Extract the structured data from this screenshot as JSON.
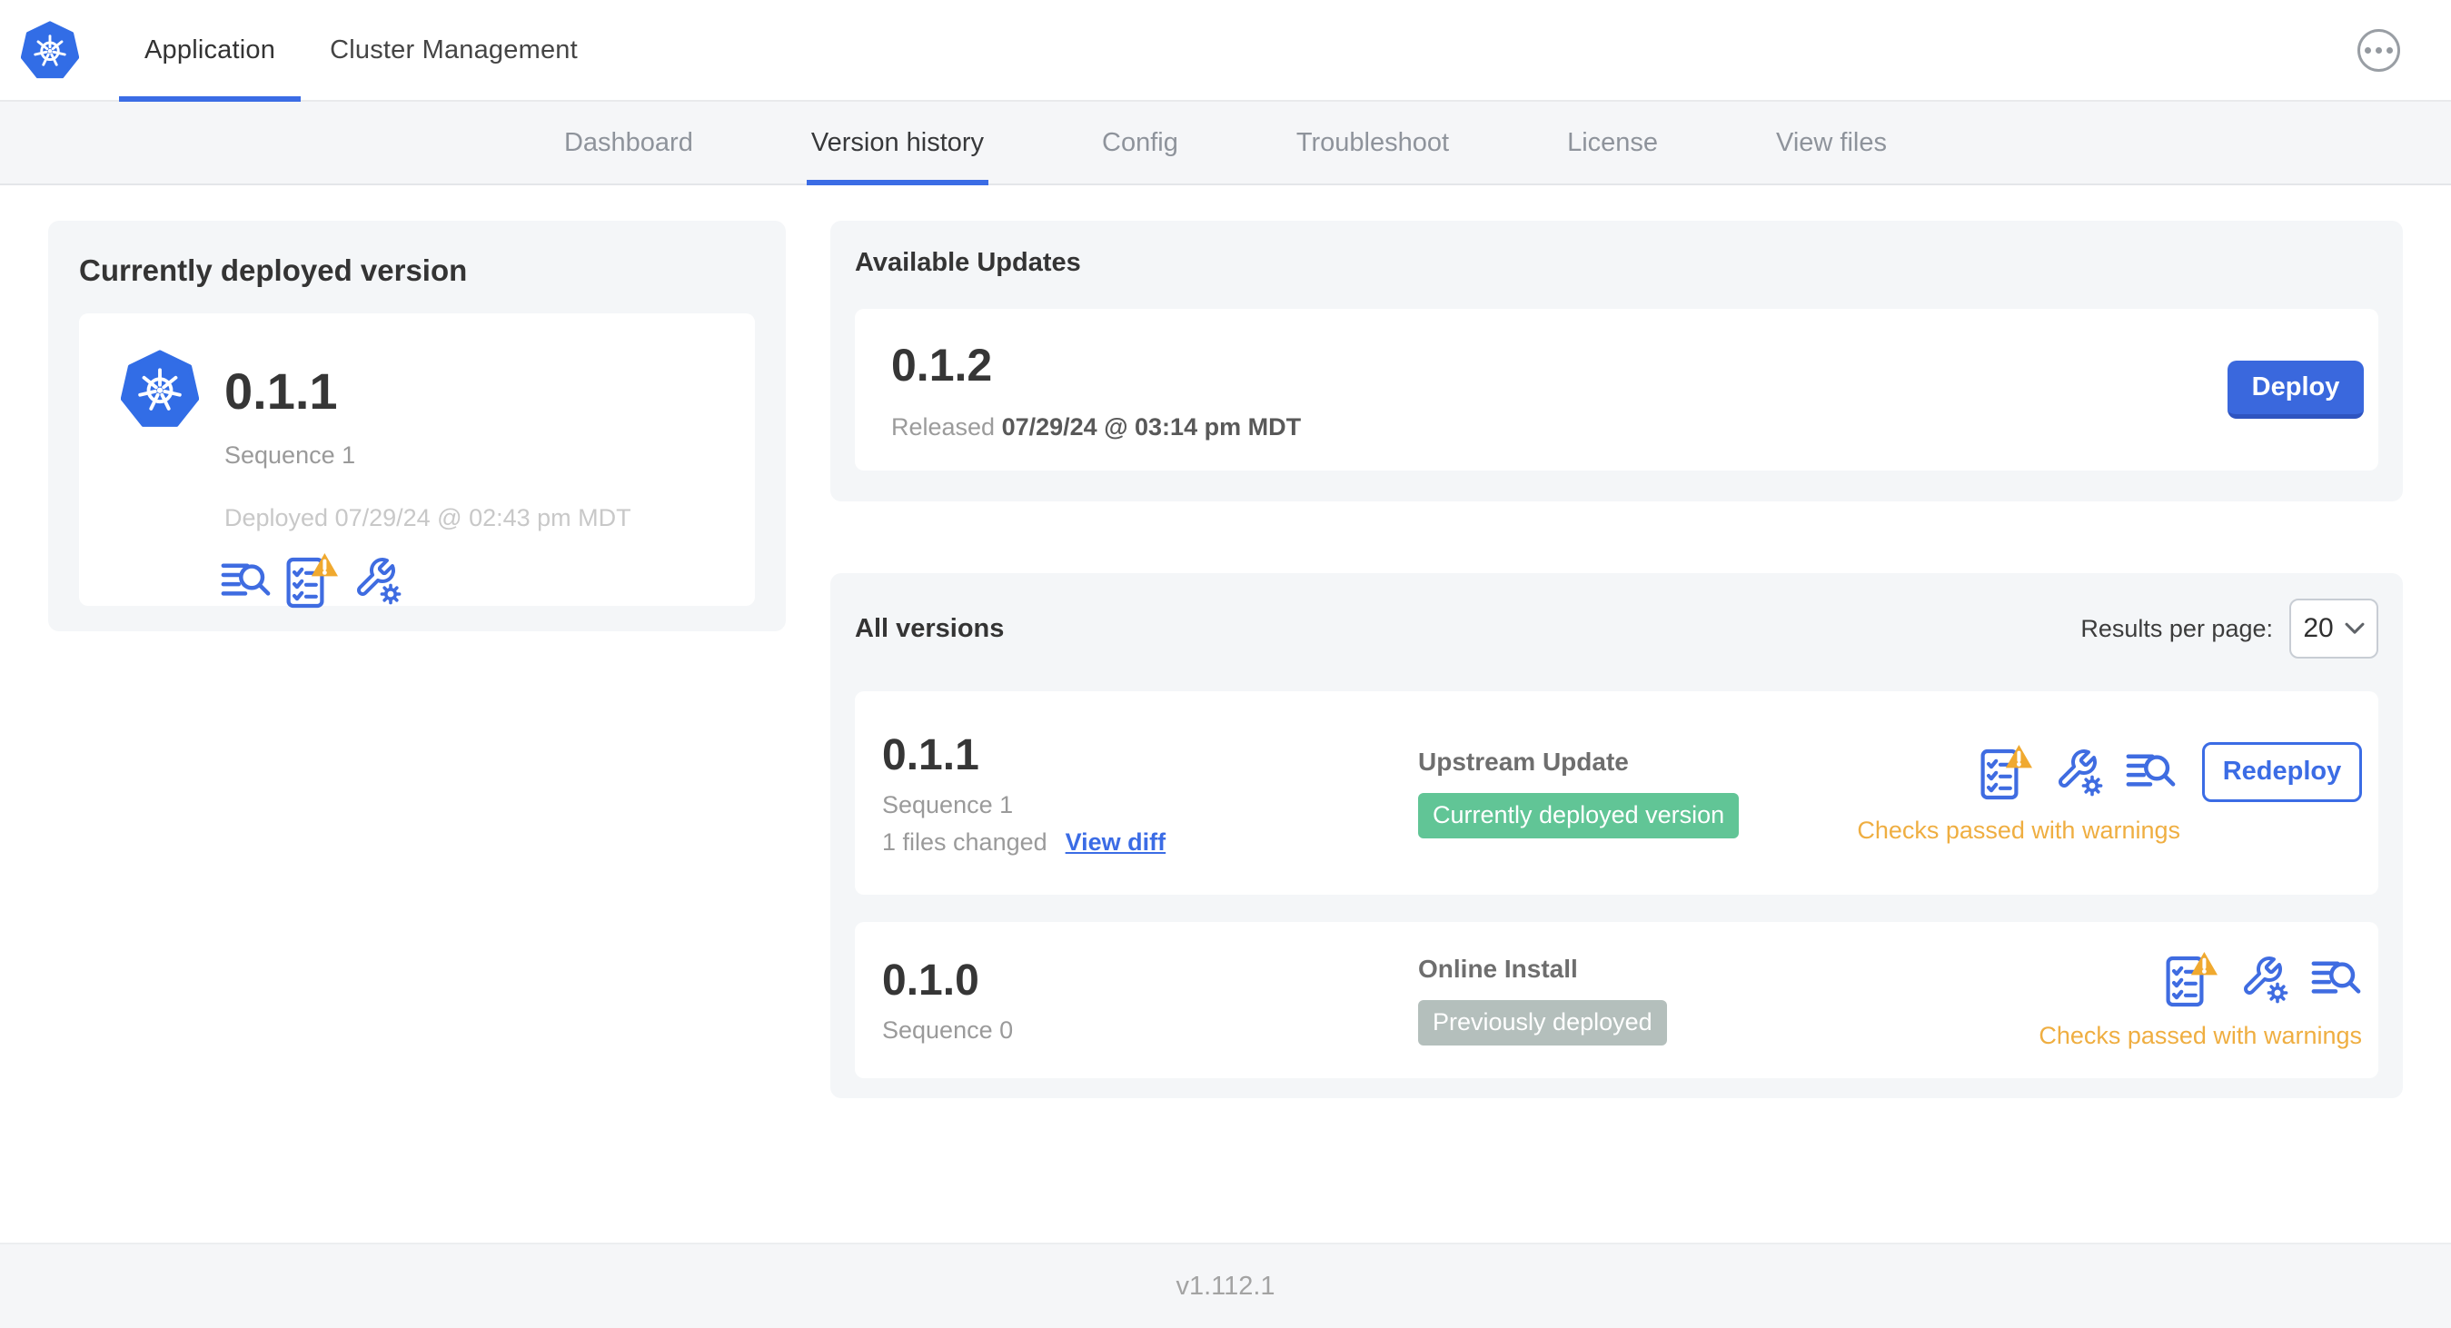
{
  "colors": {
    "accent_blue": "#3b6ce5",
    "kubernetes_blue": "#326de6",
    "badge_green": "#61c596",
    "badge_gray": "#b4bfbc",
    "warning_orange": "#efae41"
  },
  "header": {
    "tabs": [
      {
        "label": "Application",
        "active": true
      },
      {
        "label": "Cluster Management",
        "active": false
      }
    ]
  },
  "subnav": {
    "items": [
      {
        "label": "Dashboard",
        "active": false
      },
      {
        "label": "Version history",
        "active": true
      },
      {
        "label": "Config",
        "active": false
      },
      {
        "label": "Troubleshoot",
        "active": false
      },
      {
        "label": "License",
        "active": false
      },
      {
        "label": "View files",
        "active": false
      }
    ]
  },
  "deployed": {
    "title": "Currently deployed version",
    "version": "0.1.1",
    "sequence": "Sequence 1",
    "deployed_at": "Deployed 07/29/24 @ 02:43 pm MDT"
  },
  "updates": {
    "title": "Available Updates",
    "version": "0.1.2",
    "released_label": "Released",
    "released_at": "07/29/24 @ 03:14 pm MDT",
    "deploy_label": "Deploy"
  },
  "all_versions": {
    "title": "All versions",
    "results_label": "Results per page:",
    "results_value": "20",
    "rows": [
      {
        "version": "0.1.1",
        "sequence": "Sequence 1",
        "files_changed": "1 files changed",
        "view_diff_label": "View diff",
        "source": "Upstream Update",
        "badge_label": "Currently deployed version",
        "badge_color": "#61c596",
        "status_text": "Checks passed with warnings",
        "action_label": "Redeploy"
      },
      {
        "version": "0.1.0",
        "sequence": "Sequence 0",
        "source": "Online Install",
        "badge_label": "Previously deployed",
        "badge_color": "#b4bfbc",
        "status_text": "Checks passed with warnings"
      }
    ]
  },
  "footer": {
    "app_version": "v1.112.1"
  },
  "icons": {
    "logo": "kubernetes-logo",
    "menu": "ellipsis-menu-icon",
    "logs": "logs-search-icon",
    "preflight": "preflight-checks-warning-icon",
    "config": "config-wrench-icon",
    "chevron": "chevron-down-icon"
  }
}
